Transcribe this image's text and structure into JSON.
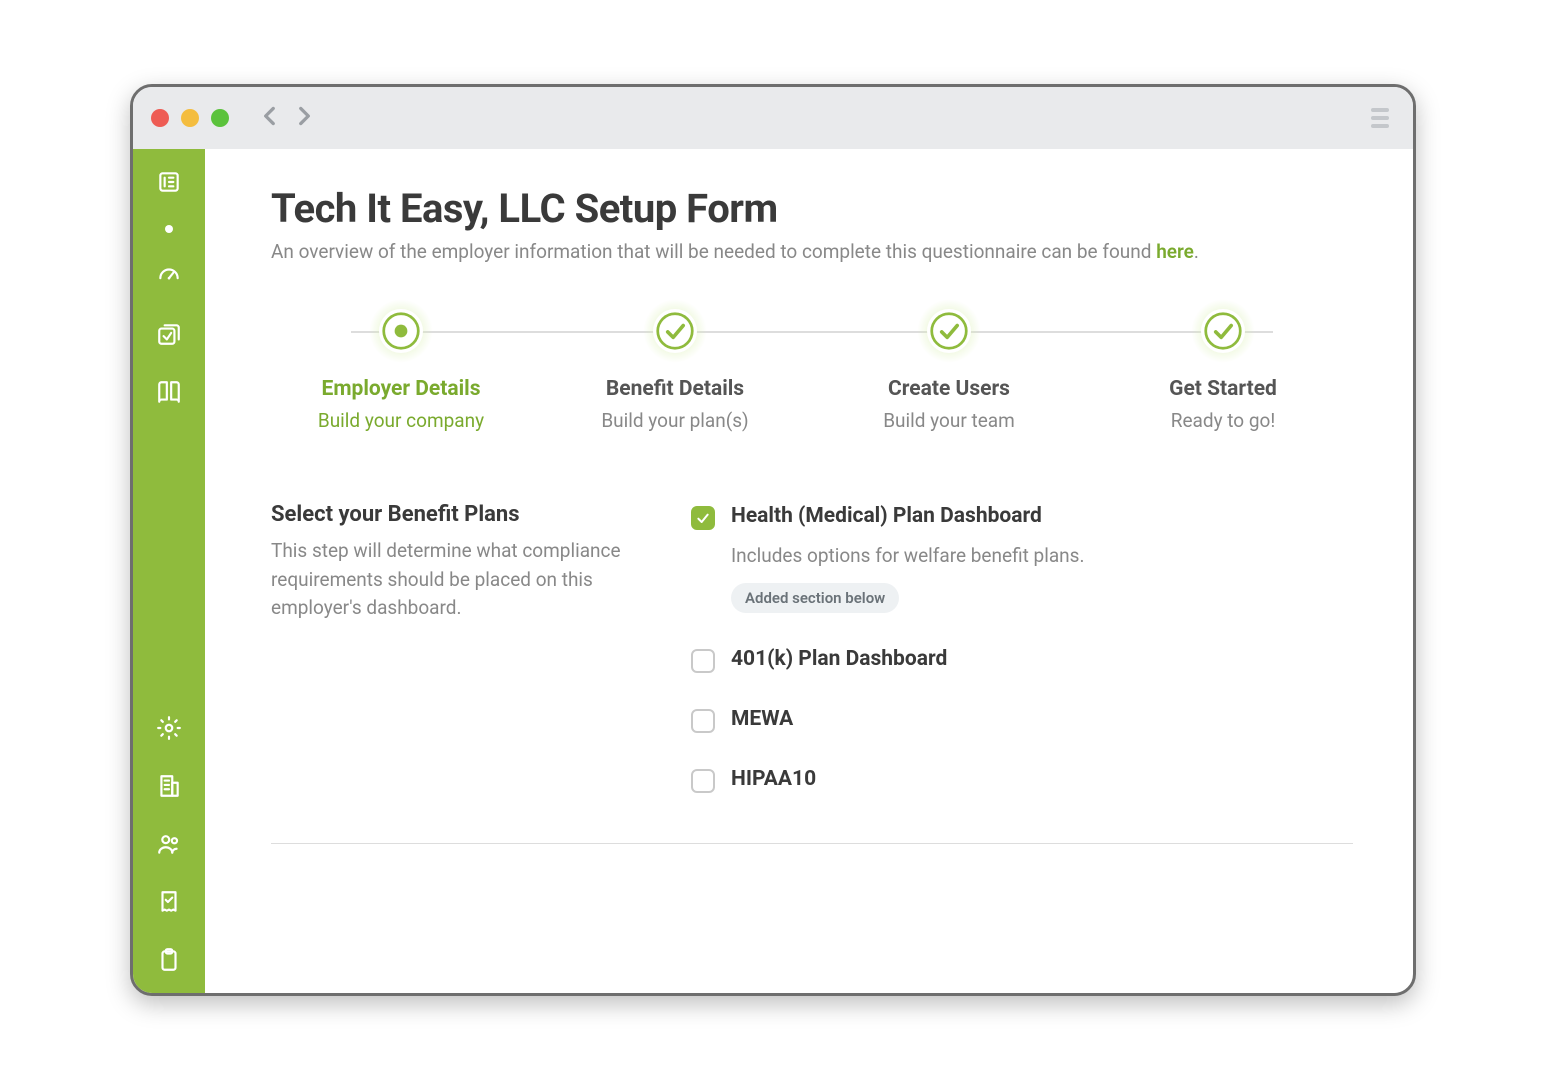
{
  "colors": {
    "accent": "#8fbb3d"
  },
  "header": {
    "title": "Tech It Easy, LLC Setup Form",
    "subtitle_pre": "An overview of the employer information that will be needed to complete this questionnaire can be found ",
    "subtitle_link": "here",
    "subtitle_post": "."
  },
  "stepper": {
    "steps": [
      {
        "title": "Employer Details",
        "sub": "Build your company",
        "state": "active"
      },
      {
        "title": "Benefit Details",
        "sub": "Build your plan(s)",
        "state": "done"
      },
      {
        "title": "Create Users",
        "sub": "Build your team",
        "state": "done"
      },
      {
        "title": "Get Started",
        "sub": "Ready to go!",
        "state": "done"
      }
    ]
  },
  "form": {
    "section_title": "Select your Benefit Plans",
    "section_desc": "This step will determine what compliance requirements should be placed on this employer's dashboard.",
    "plans": [
      {
        "label": "Health (Medical) Plan Dashboard",
        "checked": true,
        "desc": "Includes options for welfare benefit plans.",
        "badge": "Added section below"
      },
      {
        "label": "401(k) Plan Dashboard",
        "checked": false
      },
      {
        "label": "MEWA",
        "checked": false
      },
      {
        "label": "HIPAA10",
        "checked": false
      }
    ]
  },
  "sidebar": {
    "top_icons": [
      "list-icon",
      "dot-icon",
      "gauge-icon",
      "check-box-icon",
      "book-icon"
    ],
    "bottom_icons": [
      "gear-icon",
      "building-icon",
      "users-icon",
      "receipt-check-icon",
      "clipboard-icon"
    ]
  }
}
